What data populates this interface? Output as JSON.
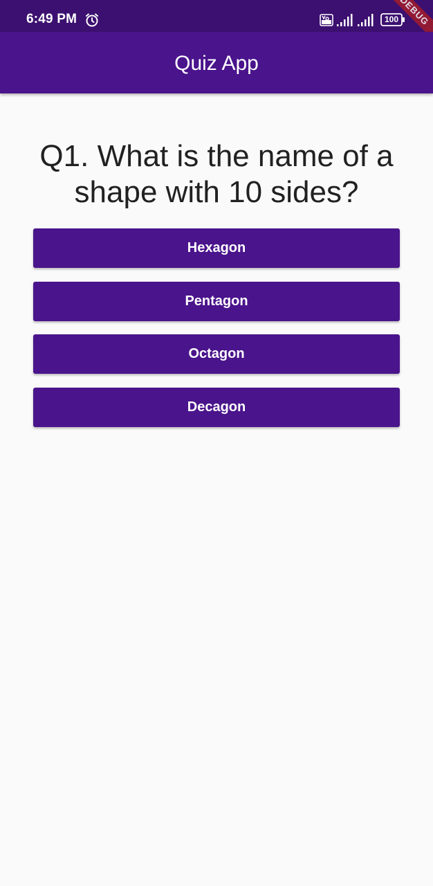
{
  "status_bar": {
    "time": "6:49 PM",
    "icons": [
      "alarm-icon",
      "volte-icon",
      "signal-icon",
      "signal-icon",
      "battery-icon"
    ],
    "battery_level": "100"
  },
  "debug_banner": "DEBUG",
  "app_bar": {
    "title": "Quiz App"
  },
  "question": {
    "text": "Q1. What is the name of a shape with 10 sides?"
  },
  "answers": [
    {
      "label": "Hexagon"
    },
    {
      "label": "Pentagon"
    },
    {
      "label": "Octagon"
    },
    {
      "label": "Decagon"
    }
  ],
  "colors": {
    "primary": "#4a148c",
    "status_bar": "#3c1070",
    "background": "#fafafa",
    "question_text": "#212121",
    "button_text": "#ffffff"
  }
}
